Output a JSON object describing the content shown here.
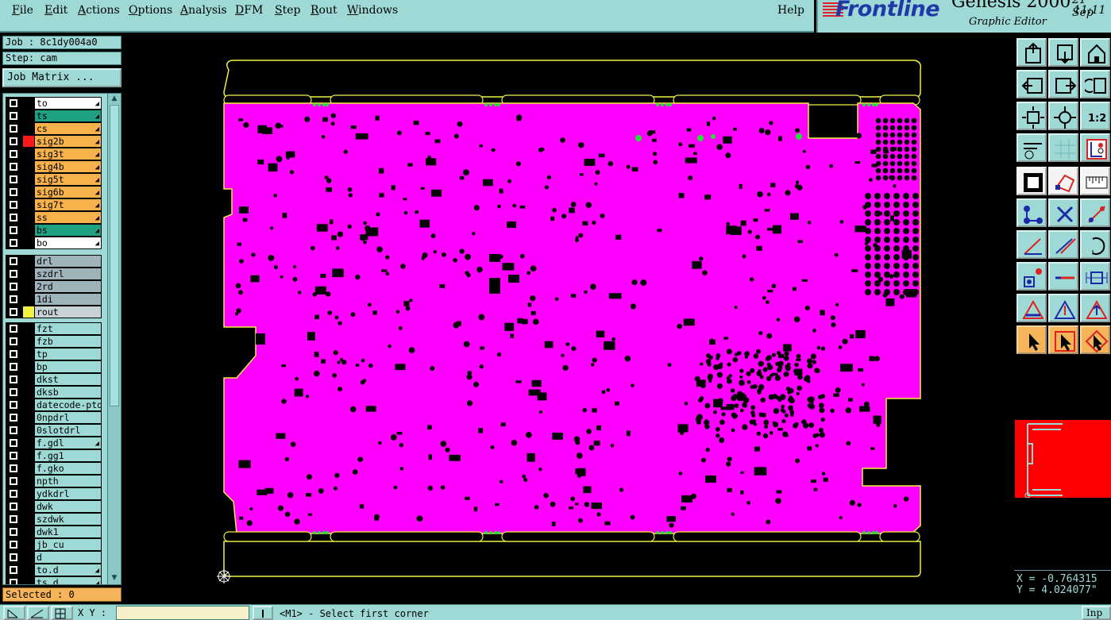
{
  "menu": {
    "items": [
      {
        "label": "File",
        "key": "F"
      },
      {
        "label": "Edit",
        "key": "E"
      },
      {
        "label": "Actions",
        "key": "A"
      },
      {
        "label": "Options",
        "key": "O"
      },
      {
        "label": "Analysis",
        "key": "A"
      },
      {
        "label": "DFM",
        "key": "D"
      },
      {
        "label": "Step",
        "key": "S"
      },
      {
        "label": "Rout",
        "key": "R"
      },
      {
        "label": "Windows",
        "key": "W"
      }
    ],
    "help": "Help"
  },
  "logo": {
    "brand": "Frontline",
    "product": "Genesis 2000",
    "subtitle": "Graphic Editor",
    "date": "21 Sep",
    "time": "11:11"
  },
  "job": {
    "job_label": "Job : 8c1dy004a0",
    "step_label": "Step: cam",
    "matrix_button": "Job Matrix ..."
  },
  "layers": {
    "board": [
      {
        "name": "to",
        "color": "#ffffff",
        "swatch": "#000000",
        "arrow": true
      },
      {
        "name": "ts",
        "color": "#1fa283",
        "swatch": "#000000",
        "arrow": true
      },
      {
        "name": "cs",
        "color": "#f7b24c",
        "swatch": "#000000",
        "arrow": true
      },
      {
        "name": "sig2b",
        "color": "#f7b24c",
        "swatch": "#ff1a1a",
        "arrow": true
      },
      {
        "name": "sig3t",
        "color": "#f7b24c",
        "swatch": "#000000",
        "arrow": true
      },
      {
        "name": "sig4b",
        "color": "#f7b24c",
        "swatch": "#000000",
        "arrow": true
      },
      {
        "name": "sig5t",
        "color": "#f7b24c",
        "swatch": "#000000",
        "arrow": true
      },
      {
        "name": "sig6b",
        "color": "#f7b24c",
        "swatch": "#000000",
        "arrow": true
      },
      {
        "name": "sig7t",
        "color": "#f7b24c",
        "swatch": "#000000",
        "arrow": true
      },
      {
        "name": "ss",
        "color": "#f7b24c",
        "swatch": "#000000",
        "arrow": true
      },
      {
        "name": "bs",
        "color": "#1fa283",
        "swatch": "#000000",
        "arrow": true
      },
      {
        "name": "bo",
        "color": "#ffffff",
        "swatch": "#000000",
        "arrow": true
      }
    ],
    "drill": [
      {
        "name": "drl",
        "color": "#9fb3ba",
        "swatch": "#000000",
        "arrow": false
      },
      {
        "name": "szdrl",
        "color": "#9fb3ba",
        "swatch": "#000000",
        "arrow": false
      },
      {
        "name": "2rd",
        "color": "#9fb3ba",
        "swatch": "#000000",
        "arrow": false
      },
      {
        "name": "1di",
        "color": "#9fb3ba",
        "swatch": "#000000",
        "arrow": false
      },
      {
        "name": "rout",
        "color": "#c8d2d6",
        "swatch": "#f2f244",
        "arrow": false
      }
    ],
    "misc": [
      {
        "name": "fzt",
        "color": "#9ed9d6",
        "arrow": false
      },
      {
        "name": "fzb",
        "color": "#9ed9d6",
        "arrow": false
      },
      {
        "name": "tp",
        "color": "#9ed9d6",
        "arrow": false
      },
      {
        "name": "bp",
        "color": "#9ed9d6",
        "arrow": false
      },
      {
        "name": "dkst",
        "color": "#9ed9d6",
        "arrow": false
      },
      {
        "name": "dksb",
        "color": "#9ed9d6",
        "arrow": false
      },
      {
        "name": "datecode-pto",
        "color": "#9ed9d6",
        "arrow": false
      },
      {
        "name": "0npdrl",
        "color": "#9ed9d6",
        "arrow": false
      },
      {
        "name": "0slotdrl",
        "color": "#9ed9d6",
        "arrow": false
      },
      {
        "name": "f.gdl",
        "color": "#9ed9d6",
        "arrow": true
      },
      {
        "name": "f.gg1",
        "color": "#9ed9d6",
        "arrow": false
      },
      {
        "name": "f.gko",
        "color": "#9ed9d6",
        "arrow": false
      },
      {
        "name": "npth",
        "color": "#9ed9d6",
        "arrow": false
      },
      {
        "name": "ydkdrl",
        "color": "#9ed9d6",
        "arrow": false
      },
      {
        "name": "dwk",
        "color": "#9ed9d6",
        "arrow": false
      },
      {
        "name": "szdwk",
        "color": "#9ed9d6",
        "arrow": false
      },
      {
        "name": "dwk1",
        "color": "#9ed9d6",
        "arrow": false
      },
      {
        "name": "jb_cu",
        "color": "#9ed9d6",
        "arrow": false
      },
      {
        "name": "d",
        "color": "#9ed9d6",
        "arrow": false
      },
      {
        "name": "to.d",
        "color": "#9ed9d6",
        "arrow": true
      },
      {
        "name": "ts.d",
        "color": "#9ed9d6",
        "arrow": true
      }
    ]
  },
  "status": {
    "selected": "Selected : 0",
    "x_readout": "X = -0.764315",
    "y_readout": "Y = 4.024077\"",
    "xy_label": "X Y :",
    "xy_value": "",
    "prompt": "<M1> - Select first corner",
    "inp_button": "Inp"
  },
  "colors": {
    "panel": "#9ed9d6",
    "board_fill": "#ff00ff",
    "outline": "#f0f040",
    "accent_orange": "#f5b35a",
    "overview": "#ff0000"
  },
  "toolbar": {
    "icons": [
      "window-up-icon",
      "window-down-icon",
      "home-icon",
      "window-left-icon",
      "window-right-icon",
      "redo-window-icon",
      "zoom-fit-icon",
      "zoom-center-icon",
      "zoom-1-2-icon",
      "measure-icon",
      "grid-icon",
      "layer-display-icon",
      "select-box-icon",
      "polygon-icon",
      "ruler-icon",
      "route-icon",
      "delete-icon",
      "move-icon",
      "line-icon",
      "line-edit-icon",
      "rotate-icon",
      "pad-icon",
      "segment-icon",
      "resize-icon",
      "triangle-a-icon",
      "triangle-b-icon",
      "triangle-c-icon",
      "pointer-icon",
      "pointer-select-icon",
      "pointer-highlight-icon"
    ],
    "zoom_label": "1:2"
  }
}
